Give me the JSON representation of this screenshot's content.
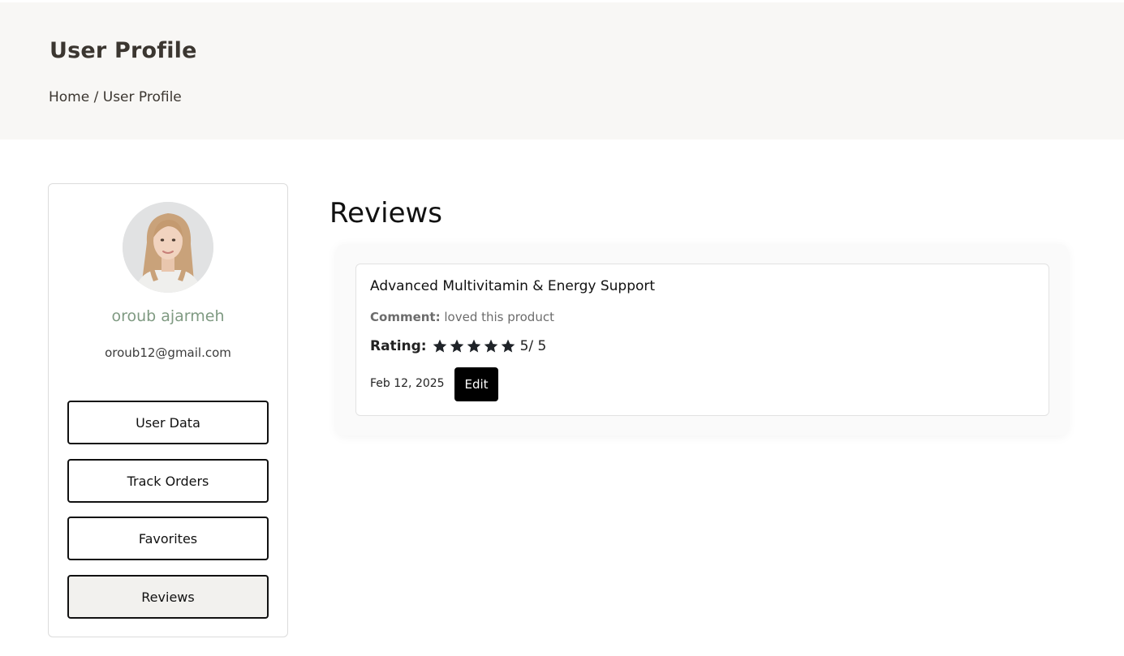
{
  "header": {
    "title": "User Profile",
    "breadcrumb": {
      "home": "Home",
      "separator": " / ",
      "current": "User Profile"
    }
  },
  "profile": {
    "name": "oroub ajarmeh",
    "email": "oroub12@gmail.com"
  },
  "nav": {
    "user_data": "User Data",
    "track_orders": "Track Orders",
    "favorites": "Favorites",
    "reviews": "Reviews",
    "active": "Reviews"
  },
  "reviews": {
    "title": "Reviews",
    "items": [
      {
        "product": "Advanced Multivitamin & Energy Support",
        "comment_label": "Comment:",
        "comment": "loved this product",
        "rating_label": "Rating:",
        "rating": 5,
        "rating_text": "5/ 5",
        "date": "Feb 12, 2025",
        "edit_label": "Edit"
      }
    ]
  },
  "colors": {
    "header_bg": "#f8f7f5",
    "name_color": "#7f9a82",
    "active_nav_bg": "#f2f1ee",
    "edit_button_bg": "#000000"
  },
  "icons": {
    "star": "star-icon"
  }
}
